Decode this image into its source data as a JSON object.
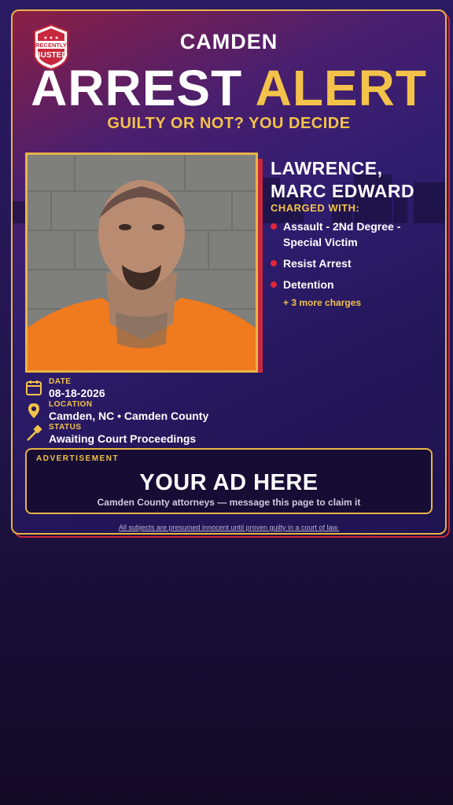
{
  "badge": {
    "line1": "RECENTLY",
    "line2": "BUSTED"
  },
  "header": {
    "city": "CAMDEN",
    "headline_white": "ARREST",
    "headline_yellow": "ALERT",
    "tagline": "GUILTY OR NOT? YOU DECIDE"
  },
  "subject": {
    "name_line1": "LAWRENCE,",
    "name_line2": "MARC EDWARD",
    "charged_label": "CHARGED WITH:",
    "charges": [
      "Assault - 2Nd Degree - Special Victim",
      "Resist Arrest",
      "Detention"
    ],
    "more_charges": "+ 3 more charges",
    "photo_icon": "mugshot-photo"
  },
  "details": {
    "date_label": "DATE",
    "date_value": "08-18-2026",
    "date_icon": "calendar-icon",
    "location_label": "LOCATION",
    "location_value": "Camden, NC • Camden County",
    "location_icon": "map-pin-icon",
    "status_label": "STATUS",
    "status_value": "Awaiting Court Proceedings",
    "status_icon": "gavel-icon"
  },
  "ad": {
    "label": "ADVERTISEMENT",
    "title": "YOUR AD HERE",
    "subtitle": "Camden County attorneys — message this page to claim it"
  },
  "footer": {
    "disclaimer": "All subjects are presumed innocent until proven guilty in a court of law."
  },
  "colors": {
    "accent_yellow": "#f2c24a",
    "accent_red": "#e0283a",
    "frame_gold": "#e8b446"
  }
}
